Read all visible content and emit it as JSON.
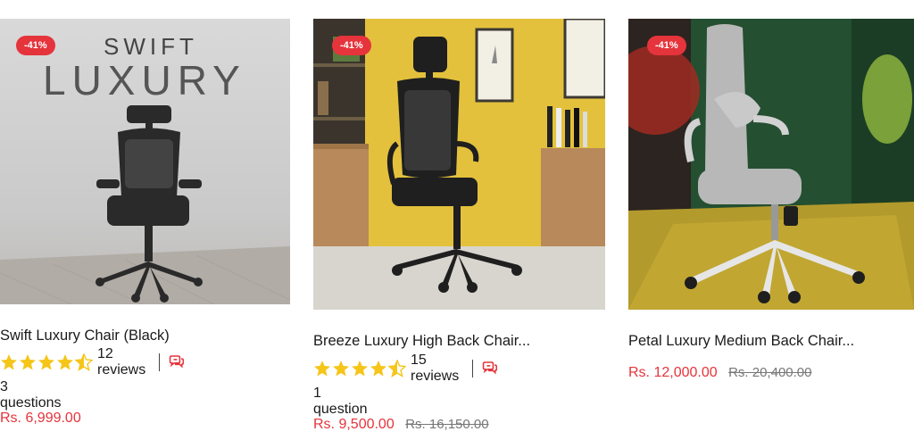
{
  "products": [
    {
      "badge": "-41%",
      "image_overlay": {
        "line1": "SWIFT",
        "line2": "LUXURY"
      },
      "title": "Swift Luxury Chair (Black)",
      "rating": 4.5,
      "reviews": "12 reviews",
      "questions": "3 questions",
      "price": "Rs. 6,999.00",
      "compare_price": ""
    },
    {
      "badge": "-41%",
      "title": "Breeze Luxury High Back Chair...",
      "rating": 4.5,
      "reviews": "15 reviews",
      "questions": "1 question",
      "price": "Rs. 9,500.00",
      "compare_price": "Rs. 16,150.00"
    },
    {
      "badge": "-41%",
      "title": "Petal Luxury Medium Back Chair...",
      "price": "Rs. 12,000.00",
      "compare_price": "Rs. 20,400.00"
    }
  ],
  "colors": {
    "accent": "#e5343b",
    "star": "#f5c518"
  },
  "icons": {
    "star": "star-icon",
    "half_star": "half-star-icon",
    "qa": "question-chat-icon"
  }
}
